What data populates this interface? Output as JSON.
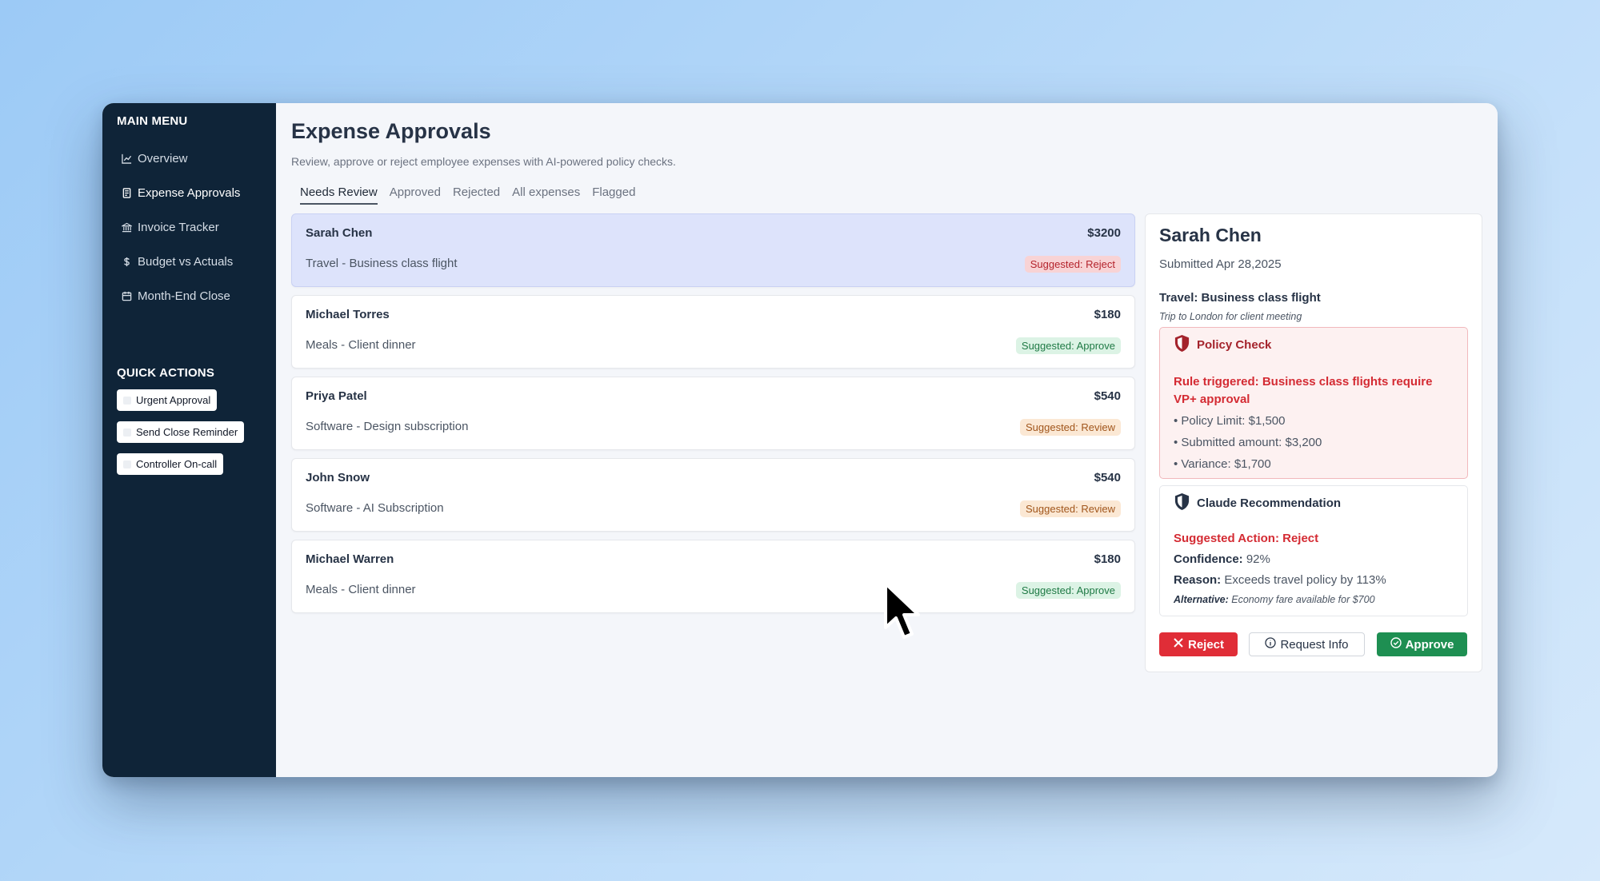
{
  "sidebar": {
    "main_menu_heading": "MAIN MENU",
    "items": [
      {
        "label": "Overview",
        "icon": "chart-line-icon"
      },
      {
        "label": "Expense Approvals",
        "icon": "receipt-icon"
      },
      {
        "label": "Invoice Tracker",
        "icon": "bank-icon"
      },
      {
        "label": "Budget vs Actuals",
        "icon": "dollar-icon"
      },
      {
        "label": "Month-End Close",
        "icon": "calendar-icon"
      }
    ],
    "active_item": "Expense Approvals",
    "quick_actions_heading": "QUICK ACTIONS",
    "quick_actions": [
      {
        "label": "Urgent Approval"
      },
      {
        "label": "Send Close Reminder"
      },
      {
        "label": "Controller On-call"
      }
    ]
  },
  "header": {
    "title": "Expense Approvals",
    "subtitle": "Review, approve or reject employee expenses with AI-powered policy checks."
  },
  "tabs": [
    {
      "label": "Needs Review",
      "active": true
    },
    {
      "label": "Approved"
    },
    {
      "label": "Rejected"
    },
    {
      "label": "All expenses"
    },
    {
      "label": "Flagged"
    }
  ],
  "expenses": [
    {
      "name": "Sarah Chen",
      "amount": "$3200",
      "description": "Travel - Business class flight",
      "suggestion": "Suggested: Reject",
      "status": "reject",
      "selected": true
    },
    {
      "name": "Michael Torres",
      "amount": "$180",
      "description": "Meals - Client dinner",
      "suggestion": "Suggested: Approve",
      "status": "approve"
    },
    {
      "name": "Priya Patel",
      "amount": "$540",
      "description": "Software - Design subscription",
      "suggestion": "Suggested: Review",
      "status": "review"
    },
    {
      "name": "John Snow",
      "amount": "$540",
      "description": "Software - AI Subscription",
      "suggestion": "Suggested: Review",
      "status": "review"
    },
    {
      "name": "Michael Warren",
      "amount": "$180",
      "description": "Meals - Client dinner",
      "suggestion": "Suggested: Approve",
      "status": "approve"
    }
  ],
  "detail": {
    "name": "Sarah Chen",
    "submitted": "Submitted Apr 28,2025",
    "category": "Travel: Business class flight",
    "note": "Trip to London for client meeting",
    "policy_check": {
      "title": "Policy Check",
      "rule": "Rule triggered: Business class flights require VP+ approval",
      "bullets": [
        "• Policy Limit: $1,500",
        "• Submitted amount: $3,200",
        "• Variance: $1,700"
      ]
    },
    "recommendation": {
      "title": "Claude Recommendation",
      "action": "Suggested Action: Reject",
      "confidence_label": "Confidence:",
      "confidence_value": "92%",
      "reason_label": "Reason:",
      "reason_value": "Exceeds travel policy by 113%",
      "alternative_label": "Alternative:",
      "alternative_value": "Economy fare available for $700"
    },
    "buttons": {
      "reject": "Reject",
      "request_info": "Request Info",
      "approve": "Approve"
    }
  },
  "colors": {
    "sidebar_bg": "#0f2438",
    "reject": "#e02d37",
    "approve": "#1e8f52",
    "selected_card": "#dde3fb"
  }
}
